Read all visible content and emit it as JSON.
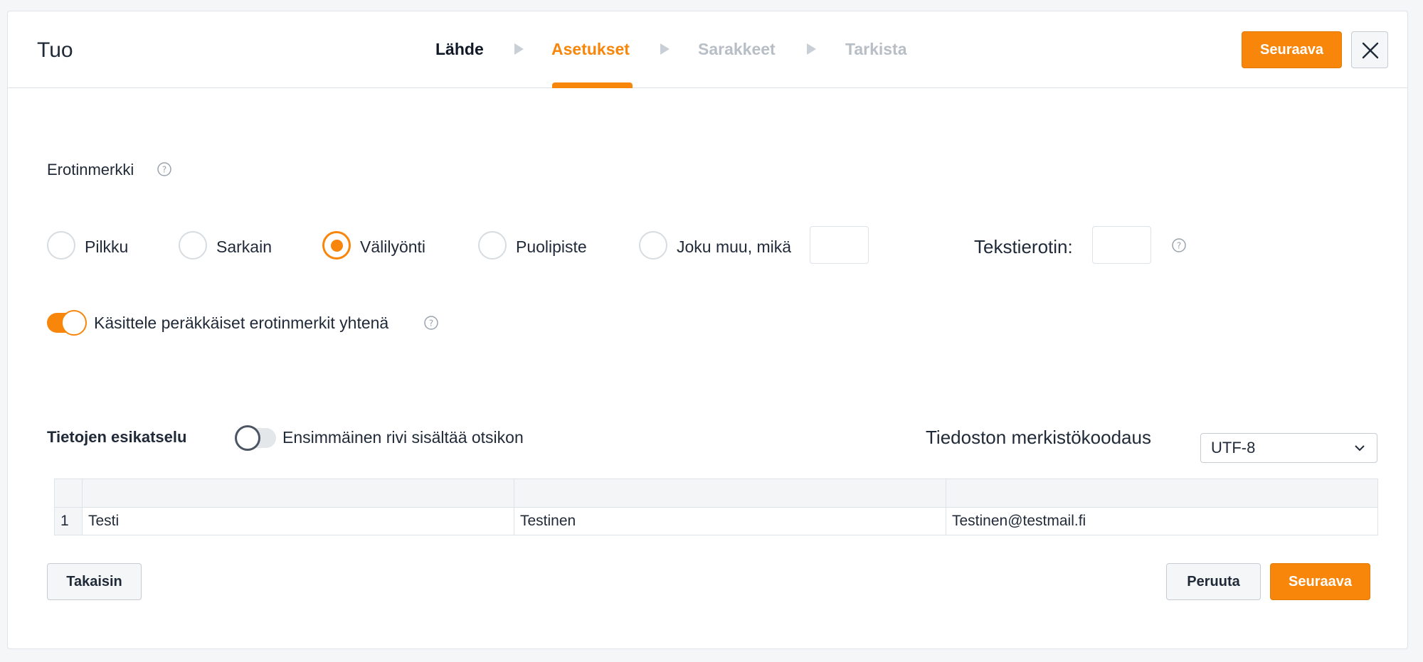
{
  "header": {
    "title": "Tuo",
    "steps": [
      {
        "label": "Lähde",
        "state": "done"
      },
      {
        "label": "Asetukset",
        "state": "active"
      },
      {
        "label": "Sarakkeet",
        "state": "todo"
      },
      {
        "label": "Tarkista",
        "state": "todo"
      }
    ],
    "next_label": "Seuraava",
    "close_icon": "close-icon"
  },
  "delimiter": {
    "label": "Erotinmerkki",
    "options": [
      {
        "label": "Pilkku",
        "checked": false
      },
      {
        "label": "Sarkain",
        "checked": false
      },
      {
        "label": "Välilyönti",
        "checked": true
      },
      {
        "label": "Puolipiste",
        "checked": false
      },
      {
        "label": "Joku muu, mikä",
        "checked": false
      }
    ],
    "other_value": "",
    "text_qualifier_label": "Tekstierotin:",
    "text_qualifier_value": ""
  },
  "consecutive": {
    "label": "Käsittele peräkkäiset erotinmerkit yhtenä",
    "enabled": true
  },
  "preview": {
    "title": "Tietojen esikatselu",
    "header_row_label": "Ensimmäinen rivi sisältää otsikon",
    "header_row_enabled": false,
    "encoding_label": "Tiedoston merkistökoodaus",
    "encoding_value": "UTF-8",
    "columns": [
      "",
      "",
      ""
    ],
    "rows": [
      {
        "num": "1",
        "cells": [
          "Testi",
          "Testinen",
          "Testinen@testmail.fi"
        ]
      }
    ]
  },
  "footer": {
    "back_label": "Takaisin",
    "cancel_label": "Peruuta",
    "next_label": "Seuraava"
  },
  "colors": {
    "accent": "#f7860b",
    "border": "#dde3e8",
    "muted_step": "#b7bec6"
  }
}
